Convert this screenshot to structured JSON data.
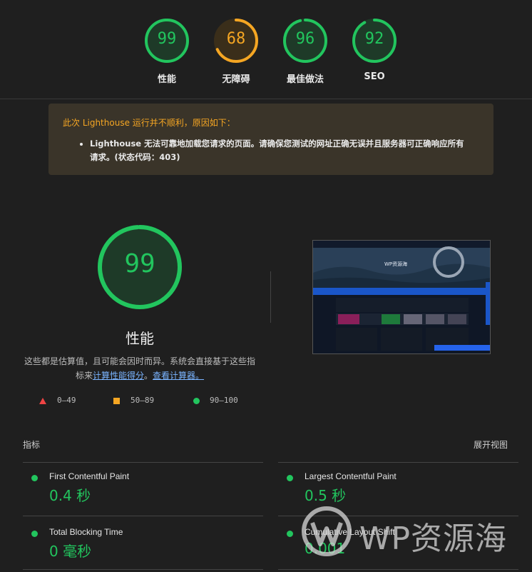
{
  "scores": [
    {
      "value": "99",
      "label": "性能",
      "color": "#22c55e",
      "fraction": 0.99
    },
    {
      "value": "68",
      "label": "无障碍",
      "color": "#f5a623",
      "fraction": 0.68
    },
    {
      "value": "96",
      "label": "最佳做法",
      "color": "#22c55e",
      "fraction": 0.96
    },
    {
      "value": "92",
      "label": "SEO",
      "color": "#22c55e",
      "fraction": 0.92
    }
  ],
  "warning": {
    "title": "此次 Lighthouse 运行并不顺利，原因如下：",
    "item_line1": "Lighthouse 无法可靠地加载您请求的页面。请确保您测试的网址正确无误并且服务器可正确响应所有",
    "item_line2": "请求。(状态代码：403)"
  },
  "performance": {
    "score": "99",
    "fraction": 0.99,
    "title": "性能",
    "desc_line1": "这些都是估算值，且可能会因时而异。系统会直接基于这些指",
    "desc_line2_prefix": "标来",
    "link_score": "计算性能得分",
    "desc_sep": "。",
    "link_calc": "查看计算器。"
  },
  "legend": [
    {
      "shape": "triangle",
      "text": "0–49",
      "color": "#ef4444"
    },
    {
      "shape": "square",
      "text": "50–89",
      "color": "#f5a623"
    },
    {
      "shape": "circle",
      "text": "90–100",
      "color": "#22c55e"
    }
  ],
  "thumbnail": {
    "site_title": "WP资源海"
  },
  "metrics": {
    "header": "指标",
    "expand": "展开视图",
    "items": [
      {
        "name": "First Contentful Paint",
        "value": "0.4 秒"
      },
      {
        "name": "Largest Contentful Paint",
        "value": "0.5 秒"
      },
      {
        "name": "Total Blocking Time",
        "value": "0 毫秒"
      },
      {
        "name": "Cumulative Layout Shift",
        "value": "0.001"
      }
    ]
  },
  "watermark": {
    "text": "WP资源海"
  }
}
